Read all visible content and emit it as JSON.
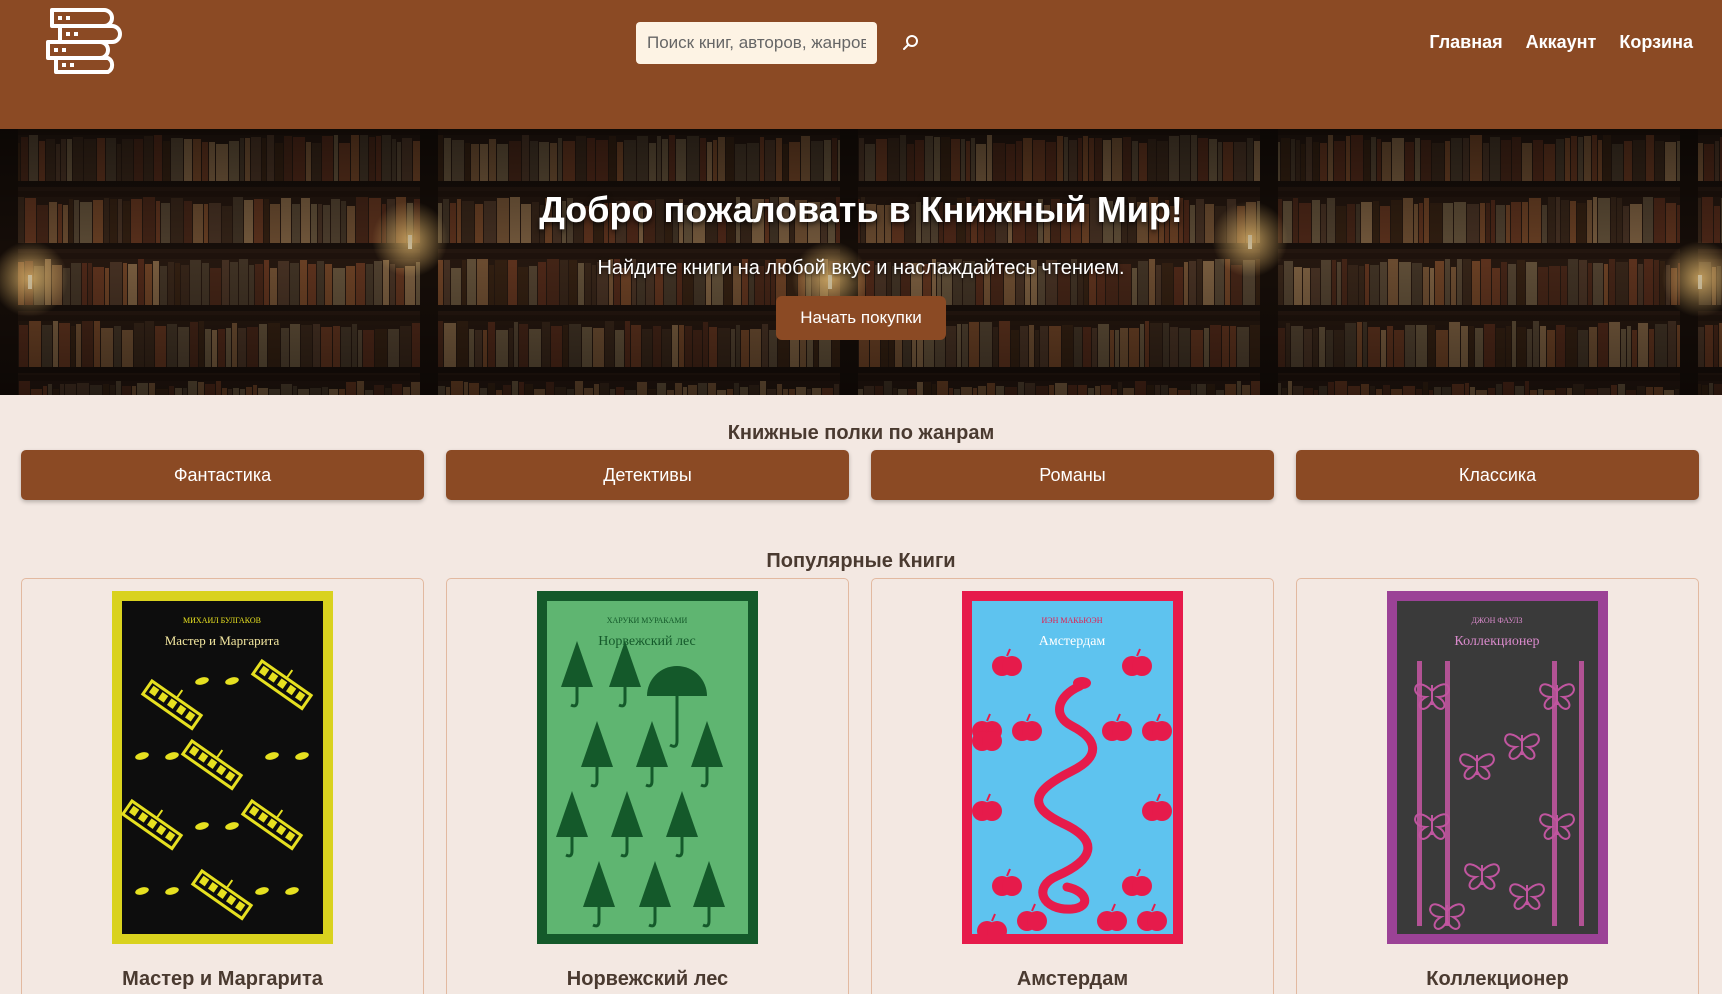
{
  "header": {
    "search_placeholder": "Поиск книг, авторов, жанров",
    "nav": [
      "Главная",
      "Аккаунт",
      "Корзина"
    ],
    "brand_color": "#8b4a24"
  },
  "hero": {
    "title": "Добро пожаловать в Книжный Мир!",
    "subtitle": "Найдите книги на любой вкус и наслаждайтесь чтением.",
    "cta_label": "Начать покупки"
  },
  "genres": {
    "title": "Книжные полки по жанрам",
    "items": [
      "Фантастика",
      "Детективы",
      "Романы",
      "Классика"
    ]
  },
  "popular": {
    "title": "Популярные Книги",
    "books": [
      {
        "title": "Мастер и Маргарита",
        "cover_author": "МИХАИЛ БУЛГАКОВ",
        "cover_title": "Мастер и Маргарита",
        "cover_bg": "#0d0d0d",
        "cover_border": "#d9d21e",
        "cover_accent": "#e6e020"
      },
      {
        "title": "Норвежский лес",
        "cover_author": "ХАРУКИ МУРАКАМИ",
        "cover_title": "Норвежский лес",
        "cover_bg": "#5fb571",
        "cover_border": "#14592a",
        "cover_accent": "#14592a"
      },
      {
        "title": "Амстердам",
        "cover_author": "ИЭН МАКЬЮЭН",
        "cover_title": "Амстердам",
        "cover_bg": "#5ec3ef",
        "cover_border": "#e61b4b",
        "cover_accent": "#e61b4b"
      },
      {
        "title": "Коллекционер",
        "cover_author": "ДЖОН ФАУЛЗ",
        "cover_title": "Коллекционер",
        "cover_bg": "#3a3a3a",
        "cover_border": "#9b4296",
        "cover_accent": "#c0559f"
      }
    ]
  }
}
